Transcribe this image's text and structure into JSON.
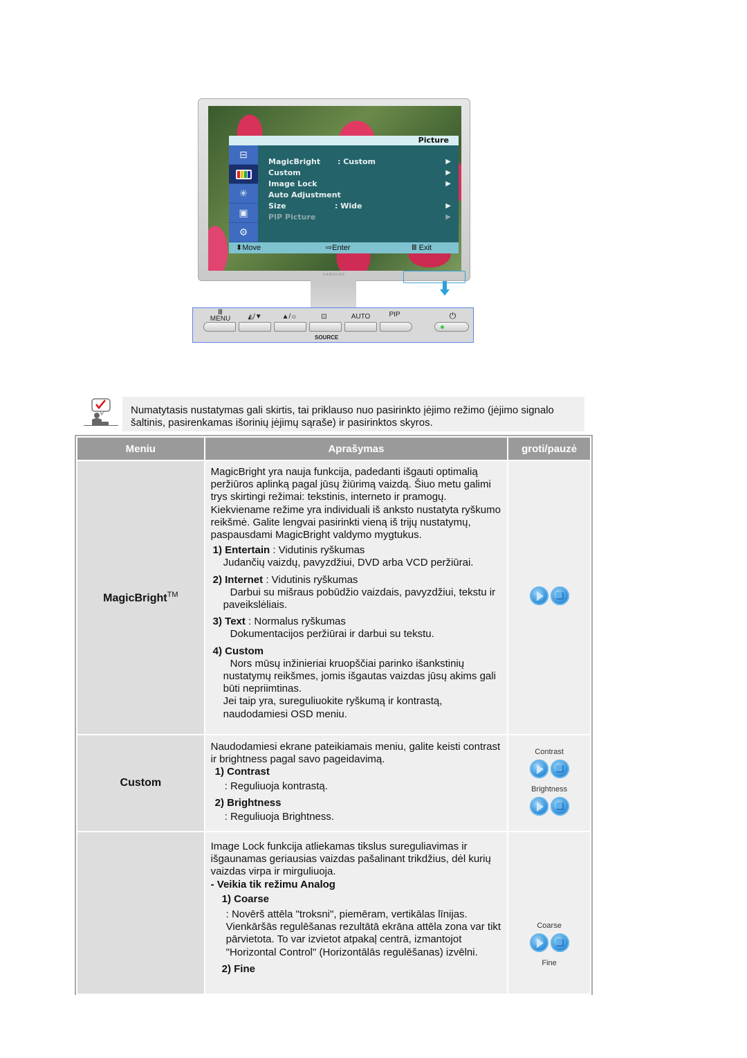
{
  "monitor": {
    "osd": {
      "title": "Picture",
      "items": [
        {
          "label": "MagicBright",
          "value": ": Custom",
          "arrow": "▶",
          "enabled": true
        },
        {
          "label": "Custom",
          "value": "",
          "arrow": "▶",
          "enabled": true
        },
        {
          "label": "Image Lock",
          "value": "",
          "arrow": "▶",
          "enabled": true
        },
        {
          "label": "Auto Adjustment",
          "value": "",
          "arrow": "",
          "enabled": true
        },
        {
          "label": "Size",
          "value": ": Wide",
          "arrow": "▶",
          "enabled": true
        },
        {
          "label": "PIP Picture",
          "value": "",
          "arrow": "▶",
          "enabled": false
        }
      ],
      "side_icons": [
        "input-icon",
        "color-bars-icon",
        "magic-wand-icon",
        "pip-window-icon",
        "equalizer-icon"
      ],
      "footer": {
        "move": "⬍Move",
        "enter": "⇨Enter",
        "exit": "Ⅲ Exit"
      }
    },
    "brand": "SAMSUNG",
    "panel": {
      "buttons": [
        {
          "label": "MENU",
          "icon": "Ⅲ"
        },
        {
          "label": "◭/▼",
          "icon": ""
        },
        {
          "label": "▲/☼",
          "icon": ""
        },
        {
          "label": "⊡",
          "icon": ""
        },
        {
          "label": "AUTO",
          "icon": ""
        },
        {
          "label": "PIP",
          "icon": ""
        }
      ],
      "source_label": "SOURCE",
      "power_icon": "⏻"
    }
  },
  "note": {
    "text": "Numatytasis nustatymas gali skirtis, tai priklauso nuo pasirinkto įėjimo režimo (įėjimo signalo šaltinis, pasirenkamas išorinių įėjimų sąraše) ir pasirinktos skyros."
  },
  "table": {
    "headers": {
      "menu": "Meniu",
      "description": "Aprašymas",
      "play": "groti/pauzė"
    },
    "rows": [
      {
        "menu": "MagicBright",
        "menu_sup": "TM",
        "intro": "MagicBright yra nauja funkcija, padedanti išgauti optimalią peržiūros aplinką pagal jūsų žiūrimą vaizdą. Šiuo metu galimi trys skirtingi režimai: tekstinis, interneto ir pramogų. Kiekviename režime yra individuali iš anksto nustatyta ryškumo reikšmė. Galite lengvai pasirinkti vieną iš trijų nustatymų, paspausdami MagicBright valdymo mygtukus.",
        "items": [
          {
            "num": "1)",
            "name": "Entertain",
            "summary": " : Vidutinis ryškumas",
            "detail": "Judančių vaizdų, pavyzdžiui, DVD arba VCD peržiūrai."
          },
          {
            "num": "2)",
            "name": "Internet",
            "summary": " : Vidutinis ryškumas",
            "detail": "Darbui su mišraus pobūdžio vaizdais, pavyzdžiui, tekstu ir paveikslėliais."
          },
          {
            "num": "3)",
            "name": "Text",
            "summary": " : Normalus ryškumas",
            "detail": "Dokumentacijos peržiūrai ir darbui su tekstu."
          },
          {
            "num": "4)",
            "name": "Custom",
            "summary": "",
            "detail": "Nors mūsų inžinieriai kruopščiai parinko išankstinių nustatymų reikšmes, jomis išgautas vaizdas jūsų akims gali būti nepriimtinas.",
            "detail2": "Jei taip yra, sureguliuokite ryškumą ir kontrastą, naudodamiesi OSD meniu."
          }
        ]
      },
      {
        "menu": "Custom",
        "intro": "Naudodamiesi ekrane pateikiamais meniu, galite keisti contrast ir brightness pagal savo pageidavimą.",
        "items": [
          {
            "num": "1)",
            "name": "Contrast",
            "detail": ": Reguliuoja kontrastą."
          },
          {
            "num": "2)",
            "name": "Brightness",
            "detail": ": Reguliuoja Brightness."
          }
        ],
        "play_captions": [
          "Contrast",
          "Brightness"
        ]
      },
      {
        "menu": "",
        "intro": "Image Lock funkcija atliekamas tikslus sureguliavimas ir išgaunamas geriausias vaizdas pašalinant trikdžius, dėl kurių vaizdas virpa ir mirguliuoja.",
        "note": "- Veikia tik režimu Analog",
        "items": [
          {
            "num": "1)",
            "name": "Coarse",
            "detail": ": Novērš attēla \"troksni\", piemēram, vertikālas līnijas. Vienkāršās regulēšanas rezultātā ekrāna attēla zona var tikt pārvietota. To var izvietot atpakaļ centrā, izmantojot \"Horizontal Control\" (Horizontālās regulēšanas) izvēlni."
          },
          {
            "num": "2)",
            "name": "Fine",
            "detail": ""
          }
        ],
        "play_captions": [
          "Coarse",
          "Fine"
        ]
      }
    ]
  }
}
